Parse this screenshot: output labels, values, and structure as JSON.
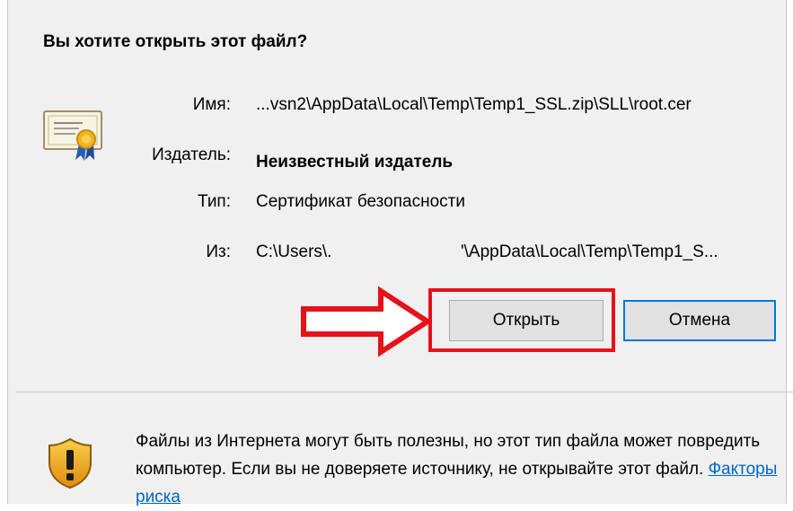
{
  "dialog": {
    "heading": "Вы хотите открыть этот файл?",
    "fields": {
      "name_label": "Имя:",
      "name_value": "...vsn2\\AppData\\Local\\Temp\\Temp1_SSL.zip\\SLL\\root.cer",
      "publisher_label": "Издатель:",
      "publisher_value": "Неизвестный издатель",
      "type_label": "Тип:",
      "type_value": "Сертификат безопасности",
      "from_label": "Из:",
      "from_value_start": "C:\\Users\\.",
      "from_value_end": "'\\AppData\\Local\\Temp\\Temp1_S..."
    },
    "buttons": {
      "open_label": "Открыть",
      "cancel_label": "Отмена"
    },
    "warning": {
      "text": "Файлы из Интернета могут быть полезны, но этот тип файла может повредить компьютер. Если вы не доверяете источнику, не открывайте этот файл. ",
      "link_label": "Факторы риска"
    },
    "icons": {
      "file_icon": "certificate-icon",
      "warning_icon": "shield-warning-icon"
    },
    "colors": {
      "highlight_red": "#e5121b",
      "link_blue": "#0066cc",
      "focus_blue": "#0078d7"
    }
  }
}
